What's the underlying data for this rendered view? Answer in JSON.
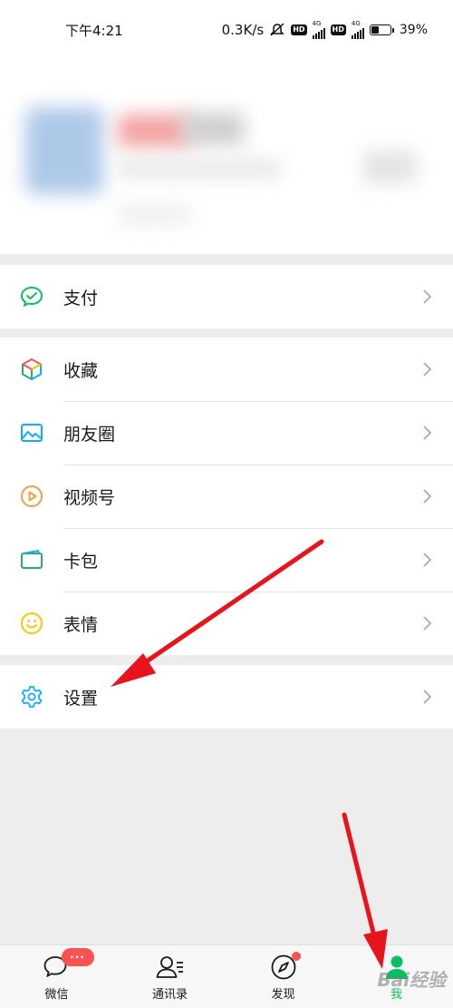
{
  "status_bar": {
    "time": "下午4:21",
    "network_speed": "0.3K/s",
    "network_type_1": "4G",
    "network_type_2": "4G",
    "hd_label_1": "HD",
    "hd_label_2": "HD",
    "battery_percent": "39%",
    "battery_level": 0.39
  },
  "menu": {
    "pay": {
      "label": "支付",
      "icon": "wechat-pay-icon"
    },
    "favorites": {
      "label": "收藏",
      "icon": "cube-icon"
    },
    "moments": {
      "label": "朋友圈",
      "icon": "image-icon"
    },
    "channels": {
      "label": "视频号",
      "icon": "play-circle-icon"
    },
    "cards": {
      "label": "卡包",
      "icon": "wallet-icon"
    },
    "stickers": {
      "label": "表情",
      "icon": "smiley-icon"
    },
    "settings": {
      "label": "设置",
      "icon": "gear-icon"
    }
  },
  "tabbar": {
    "chats": {
      "label": "微信",
      "badge": "···"
    },
    "contacts": {
      "label": "通讯录"
    },
    "discover": {
      "label": "发现"
    },
    "me": {
      "label": "我"
    }
  },
  "colors": {
    "accent": "#07c160",
    "badge": "#fa5151",
    "arrow": "#e8141b",
    "background": "#ededed"
  },
  "watermark": "Bai经验"
}
